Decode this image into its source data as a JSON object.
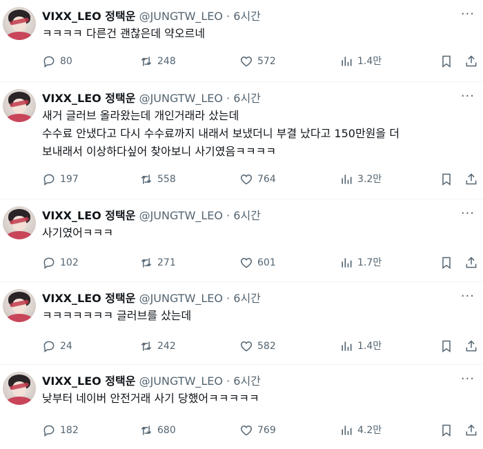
{
  "tweets": [
    {
      "name": "VIXX_LEO 정택운",
      "handle": "@JUNGTW_LEO",
      "separator": "·",
      "time": "6시간",
      "text": "ㅋㅋㅋㅋ 다른건 괜찮은데 약오르네",
      "replies": "80",
      "retweets": "248",
      "likes": "572",
      "views": "1.4만"
    },
    {
      "name": "VIXX_LEO 정택운",
      "handle": "@JUNGTW_LEO",
      "separator": "·",
      "time": "6시간",
      "text": "새거 글러브 올라왔는데 개인거래라 샀는데\n수수료 안냈다고 다시 수수료까지 내래서 보냈더니 부결 났다고 150만원을 더\n보내래서 이상하다싶어 찾아보니 사기였음ㅋㅋㅋㅋ",
      "replies": "197",
      "retweets": "558",
      "likes": "764",
      "views": "3.2만"
    },
    {
      "name": "VIXX_LEO 정택운",
      "handle": "@JUNGTW_LEO",
      "separator": "·",
      "time": "6시간",
      "text": "사기였어ㅋㅋㅋ",
      "replies": "102",
      "retweets": "271",
      "likes": "601",
      "views": "1.7만"
    },
    {
      "name": "VIXX_LEO 정택운",
      "handle": "@JUNGTW_LEO",
      "separator": "·",
      "time": "6시간",
      "text": "ㅋㅋㅋㅋㅋㅋㅋ 글러브를 샀는데",
      "replies": "24",
      "retweets": "242",
      "likes": "582",
      "views": "1.4만"
    },
    {
      "name": "VIXX_LEO 정택운",
      "handle": "@JUNGTW_LEO",
      "separator": "·",
      "time": "6시간",
      "text": "낮부터 네이버 안전거래 사기 당했어ㅋㅋㅋㅋㅋ",
      "replies": "182",
      "retweets": "680",
      "likes": "769",
      "views": "4.2만"
    }
  ],
  "icons": {
    "reply": "reply-icon",
    "retweet": "retweet-icon",
    "like": "heart-icon",
    "views": "views-icon",
    "bookmark": "bookmark-icon",
    "share": "share-icon",
    "more": "more-icon"
  },
  "colors": {
    "text": "#0f1419",
    "muted": "#536471",
    "divider": "#eff3f4"
  }
}
